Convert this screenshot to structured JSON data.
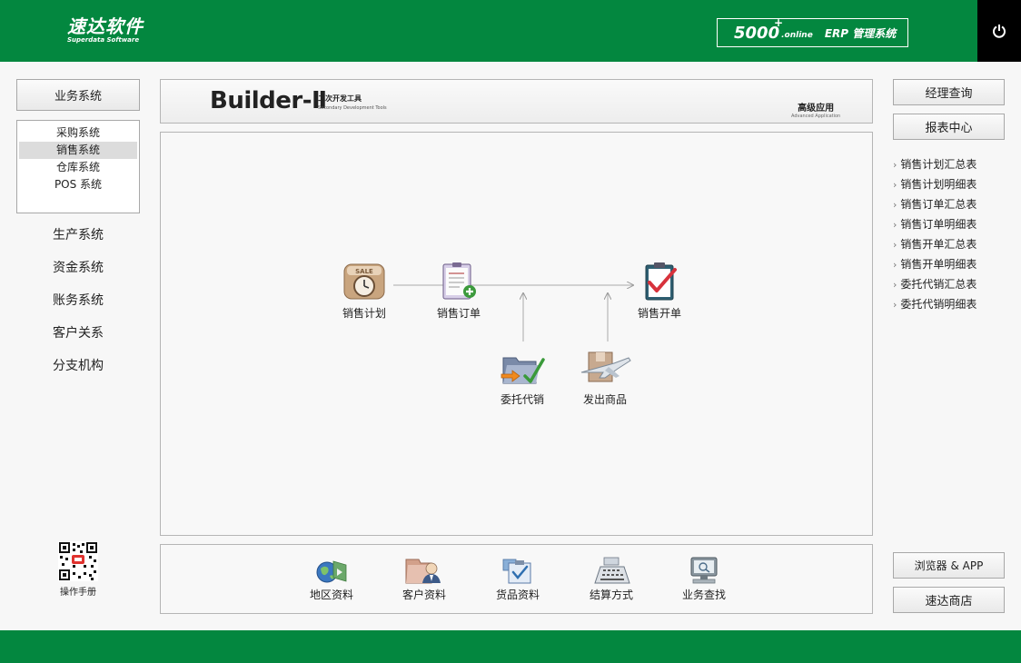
{
  "header": {
    "logo_main": "速达软件",
    "logo_sub": "Superdata Software",
    "product_number": "5000",
    "product_plus": "+",
    "product_online": ".online",
    "product_name": "ERP 管理系统",
    "power_icon": "power-icon"
  },
  "left_nav": {
    "business_label": "业务系统",
    "sub_items": [
      "采购系统",
      "销售系统",
      "仓库系统",
      "POS 系统"
    ],
    "active_sub_index": 1,
    "items": [
      "生产系统",
      "资金系统",
      "账务系统",
      "客户关系",
      "分支机构"
    ],
    "manual_label": "操作手册"
  },
  "banner": {
    "title": "Builder-Ⅱ",
    "subtitle_cn": "二次开发工具",
    "subtitle_en": "Secondary Development Tools",
    "right_cn": "高级应用",
    "right_en": "Advanced Application"
  },
  "flow": {
    "nodes": {
      "sales_plan": "销售计划",
      "sales_order": "销售订单",
      "sales_invoice": "销售开单",
      "consignment": "委托代销",
      "ship_goods": "发出商品"
    }
  },
  "shortcuts": [
    "地区资料",
    "客户资料",
    "货品资料",
    "结算方式",
    "业务查找"
  ],
  "right_nav": {
    "manager_query": "经理查询",
    "report_center": "报表中心",
    "reports": [
      "销售计划汇总表",
      "销售计划明细表",
      "销售订单汇总表",
      "销售订单明细表",
      "销售开单汇总表",
      "销售开单明细表",
      "委托代销汇总表",
      "委托代销明细表"
    ],
    "browser_app": "浏览器 & APP",
    "store": "速达商店"
  },
  "colors": {
    "brand_green": "#03873f",
    "header_black": "#000000"
  }
}
